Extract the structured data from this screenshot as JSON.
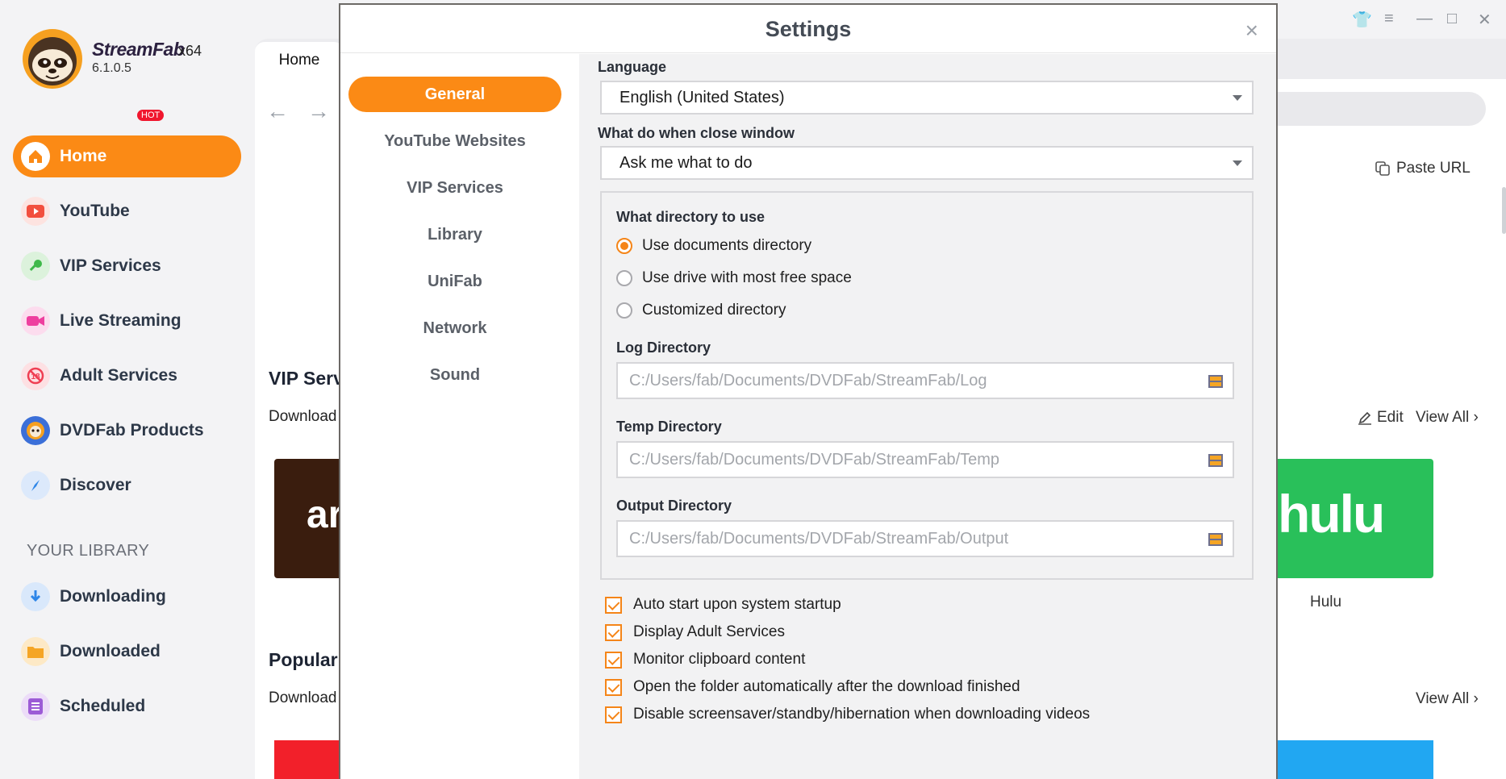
{
  "app": {
    "name": "StreamFab",
    "arch": "x64",
    "version": "6.1.0.5"
  },
  "sidebar": {
    "items": [
      {
        "label": "Home",
        "icon": "home-icon",
        "color": "#fb8a15"
      },
      {
        "label": "YouTube",
        "icon": "youtube-icon",
        "color": "#f24f3e"
      },
      {
        "label": "VIP Services",
        "icon": "key-icon",
        "color": "#3fb94a",
        "badge": "HOT"
      },
      {
        "label": "Live Streaming",
        "icon": "camera-icon",
        "color": "#ee3f9f"
      },
      {
        "label": "Adult Services",
        "icon": "adult-18-icon",
        "color": "#ef3f53"
      },
      {
        "label": "DVDFab Products",
        "icon": "dvdfab-icon",
        "color": "#3b6fd8"
      },
      {
        "label": "Discover",
        "icon": "compass-icon",
        "color": "#2f86e8"
      }
    ],
    "library_title": "YOUR LIBRARY",
    "library": [
      {
        "label": "Downloading",
        "icon": "download-arrow-icon",
        "color": "#2e86e8"
      },
      {
        "label": "Downloaded",
        "icon": "folder-icon",
        "color": "#f5a524"
      },
      {
        "label": "Scheduled",
        "icon": "list-icon",
        "color": "#9c5bd6"
      }
    ]
  },
  "main": {
    "tab_home": "Home",
    "paste_url": "Paste URL",
    "vip_title": "VIP Serv",
    "vip_sub": "Download",
    "edit": "Edit",
    "view_all": "View All",
    "popular_title": "Popular",
    "popular_sub": "Download",
    "card_amazon": "ar",
    "card_hulu": "hulu",
    "hulu_caption": "Hulu"
  },
  "settings": {
    "title": "Settings",
    "close": "×",
    "nav": [
      "General",
      "YouTube Websites",
      "VIP Services",
      "Library",
      "UniFab",
      "Network",
      "Sound"
    ],
    "active_nav": "General",
    "language_label": "Language",
    "language_value": "English (United States)",
    "close_window_label": "What do when close window",
    "close_window_value": "Ask me what to do",
    "directory_label": "What directory to use",
    "directory_options": [
      "Use documents directory",
      "Use drive with most free space",
      "Customized directory"
    ],
    "directory_selected": "Use documents directory",
    "log_label": "Log Directory",
    "log_path": "C:/Users/fab/Documents/DVDFab/StreamFab/Log",
    "temp_label": "Temp Directory",
    "temp_path": "C:/Users/fab/Documents/DVDFab/StreamFab/Temp",
    "output_label": "Output Directory",
    "output_path": "C:/Users/fab/Documents/DVDFab/StreamFab/Output",
    "checkboxes": [
      {
        "label": "Auto start upon system startup",
        "checked": true
      },
      {
        "label": "Display Adult Services",
        "checked": true
      },
      {
        "label": "Monitor clipboard content",
        "checked": true
      },
      {
        "label": "Open the folder automatically after the download finished",
        "checked": true
      },
      {
        "label": "Disable screensaver/standby/hibernation when downloading videos",
        "checked": true
      }
    ],
    "accent_color": "#fb8a15"
  }
}
